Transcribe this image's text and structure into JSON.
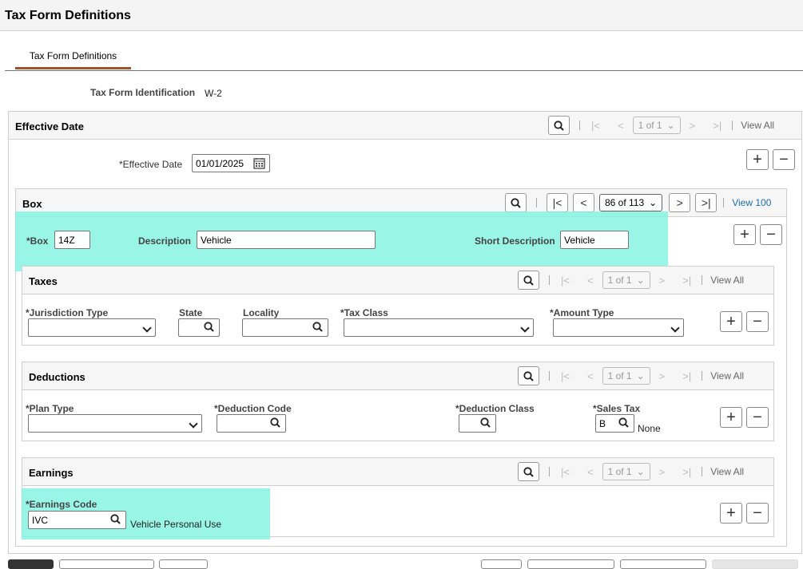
{
  "page": {
    "title": "Tax Form Definitions",
    "tab_label": "Tax Form Definitions",
    "tax_form_id_label": "Tax Form Identification",
    "tax_form_id_value": "W-2"
  },
  "effective_date": {
    "title": "Effective Date",
    "pagination": "1 of 1",
    "view_all": "View All",
    "date_label": "*Effective Date",
    "date_value": "01/01/2025"
  },
  "box": {
    "title": "Box",
    "pagination": "86 of 113",
    "view_all": "View 100",
    "box_label": "*Box",
    "box_value": "14Z",
    "description_label": "Description",
    "description_value": "Vehicle",
    "short_description_label": "Short Description",
    "short_description_value": "Vehicle"
  },
  "taxes": {
    "title": "Taxes",
    "pagination": "1 of 1",
    "view_all": "View All",
    "jurisdiction_label": "*Jurisdiction Type",
    "state_label": "State",
    "locality_label": "Locality",
    "tax_class_label": "*Tax Class",
    "amount_type_label": "*Amount Type"
  },
  "deductions": {
    "title": "Deductions",
    "pagination": "1 of 1",
    "view_all": "View All",
    "plan_type_label": "*Plan Type",
    "deduction_code_label": "*Deduction Code",
    "deduction_class_label": "*Deduction Class",
    "sales_tax_label": "*Sales Tax",
    "sales_tax_value": "B",
    "sales_tax_desc": "None"
  },
  "earnings": {
    "title": "Earnings",
    "pagination": "1 of 1",
    "view_all": "View All",
    "earnings_code_label": "*Earnings Code",
    "earnings_code_value": "IVC",
    "earnings_code_desc": "Vehicle Personal Use"
  },
  "colors": {
    "highlight": "#7ff3de",
    "tab_underline": "#a0522d",
    "link": "#1a6fb0"
  }
}
